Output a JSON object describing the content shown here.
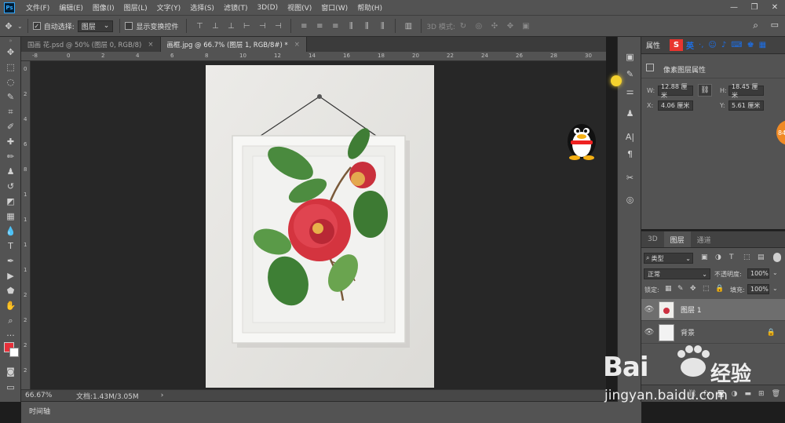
{
  "app": {
    "logo": "Ps"
  },
  "menu": [
    "文件(F)",
    "编辑(E)",
    "图像(I)",
    "图层(L)",
    "文字(Y)",
    "选择(S)",
    "滤镜(T)",
    "3D(D)",
    "视图(V)",
    "窗口(W)",
    "帮助(H)"
  ],
  "options": {
    "auto_select_label": "自动选择:",
    "auto_select_value": "图层",
    "show_transform_label": "显示变换控件",
    "mode_3d_label": "3D 模式:"
  },
  "tabs": [
    {
      "label": "国画 花.psd @ 50% (图层 0, RGB/8)",
      "close": "×"
    },
    {
      "label": "画框.jpg @ 66.7% (图层 1, RGB/8#) *",
      "close": "×"
    }
  ],
  "rulers": {
    "top": [
      "-8",
      "0",
      "2",
      "4",
      "6",
      "8",
      "10",
      "12",
      "14",
      "16",
      "18",
      "20",
      "22",
      "24",
      "26",
      "28",
      "30"
    ],
    "left": [
      "0",
      "2",
      "4",
      "6",
      "8",
      "1",
      "1",
      "1",
      "1",
      "2",
      "2",
      "2",
      "2"
    ]
  },
  "status": {
    "zoom": "66.67%",
    "doc_info": "文档:1.43M/3.05M",
    "arrow": "›"
  },
  "timeline": {
    "label": "时间轴"
  },
  "properties": {
    "title": "属性",
    "section": "像素图层属性",
    "w_label": "W:",
    "w_value": "12.88 厘米",
    "h_label": "H:",
    "h_value": "18.45 厘米",
    "x_label": "X:",
    "x_value": "4.06 厘米",
    "y_label": "Y:",
    "y_value": "5.61 厘米"
  },
  "ime": {
    "logo": "S",
    "lang": "英"
  },
  "layers_panel": {
    "tabs": [
      "3D",
      "图层",
      "通道"
    ],
    "filter_kind": "类型",
    "blend_mode": "正常",
    "opacity_label": "不透明度:",
    "opacity_value": "100%",
    "lock_label": "锁定:",
    "fill_label": "填充:",
    "fill_value": "100%",
    "layers": [
      {
        "name": "图层 1",
        "selected": true
      },
      {
        "name": "背景",
        "selected": false
      }
    ]
  },
  "badge": {
    "text": "84"
  },
  "watermark": {
    "brand": "Bai",
    "brand2": "经验",
    "url": "jingyan.baidu.com"
  },
  "colors": {
    "foreground": "#e8303a",
    "background": "#ffffff",
    "accent": "#31a8ff"
  }
}
